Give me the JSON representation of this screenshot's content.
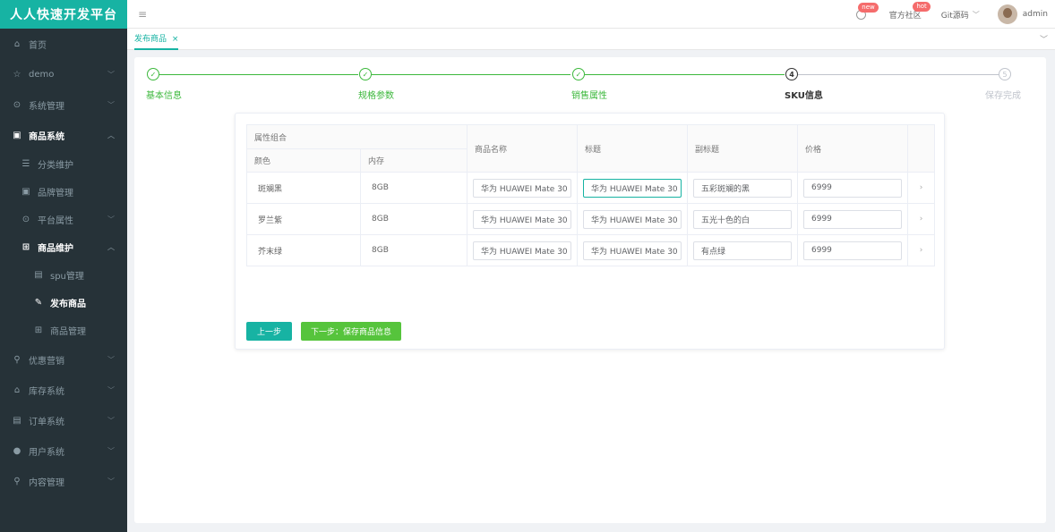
{
  "brand": "人人快速开发平台",
  "menu": [
    {
      "label": "首页",
      "icon": "home-icon",
      "glyph": "⌂"
    },
    {
      "label": "demo",
      "icon": "star-icon",
      "glyph": "☆",
      "chev": "﹀"
    },
    {
      "label": "系统管理",
      "icon": "settings-icon",
      "glyph": "⊙",
      "chev": "﹀"
    },
    {
      "label": "商品系统",
      "icon": "goods-icon",
      "glyph": "▣",
      "chev": "︿"
    },
    {
      "label": "分类维护",
      "icon": "list-icon",
      "glyph": "☰"
    },
    {
      "label": "品牌管理",
      "icon": "brand-icon",
      "glyph": "▣"
    },
    {
      "label": "平台属性",
      "icon": "attr-icon",
      "glyph": "⊙",
      "chev": "﹀"
    },
    {
      "label": "商品维护",
      "icon": "grid-icon",
      "glyph": "⊞",
      "chev": "︿"
    },
    {
      "label": "spu管理",
      "icon": "doc-icon",
      "glyph": "▤"
    },
    {
      "label": "发布商品",
      "icon": "edit-icon",
      "glyph": "✎"
    },
    {
      "label": "商品管理",
      "icon": "grid-icon",
      "glyph": "⊞"
    },
    {
      "label": "优惠营销",
      "icon": "tag-icon",
      "glyph": "⚲",
      "chev": "﹀"
    },
    {
      "label": "库存系统",
      "icon": "stock-icon",
      "glyph": "⌂",
      "chev": "﹀"
    },
    {
      "label": "订单系统",
      "icon": "order-icon",
      "glyph": "▤",
      "chev": "﹀"
    },
    {
      "label": "用户系统",
      "icon": "user-icon",
      "glyph": "●",
      "chev": "﹀"
    },
    {
      "label": "内容管理",
      "icon": "search-icon",
      "glyph": "⚲",
      "chev": "﹀"
    }
  ],
  "header": {
    "menu_toggle": "≡",
    "badge_new": "new",
    "community": "官方社区",
    "badge_hot": "hot",
    "git": "Git源码",
    "git_chev": "﹀",
    "user": "admin"
  },
  "tabs": {
    "active": "发布商品",
    "close": "×",
    "more": "﹀"
  },
  "steps": [
    {
      "label": "基本信息",
      "status": "done",
      "mark": "✓"
    },
    {
      "label": "规格参数",
      "status": "done",
      "mark": "✓"
    },
    {
      "label": "销售属性",
      "status": "done",
      "mark": "✓"
    },
    {
      "label": "SKU信息",
      "status": "active",
      "mark": "4"
    },
    {
      "label": "保存完成",
      "status": "wait",
      "mark": "5"
    }
  ],
  "table": {
    "group_header": "属性组合",
    "col_color": "颜色",
    "col_memory": "内存",
    "col_name": "商品名称",
    "col_title": "标题",
    "col_subtitle": "副标题",
    "col_price": "价格",
    "rows": [
      {
        "color": "斑斓黑",
        "memory": "8GB",
        "name": "华为 HUAWEI Mate 30",
        "title": "华为 HUAWEI Mate 30",
        "subtitle": "五彩斑斓的黑",
        "price": "6999",
        "arrow": "›"
      },
      {
        "color": "罗兰紫",
        "memory": "8GB",
        "name": "华为 HUAWEI Mate 30",
        "title": "华为 HUAWEI Mate 30",
        "subtitle": "五光十色的白",
        "price": "6999",
        "arrow": "›"
      },
      {
        "color": "芥末绿",
        "memory": "8GB",
        "name": "华为 HUAWEI Mate 30",
        "title": "华为 HUAWEI Mate 30",
        "subtitle": "有点绿",
        "price": "6999",
        "arrow": "›"
      }
    ]
  },
  "buttons": {
    "prev": "上一步",
    "next": "下一步：保存商品信息"
  },
  "colors": {
    "brand": "#17b3a3",
    "done": "#3cb83c",
    "sidebar": "#263238"
  }
}
